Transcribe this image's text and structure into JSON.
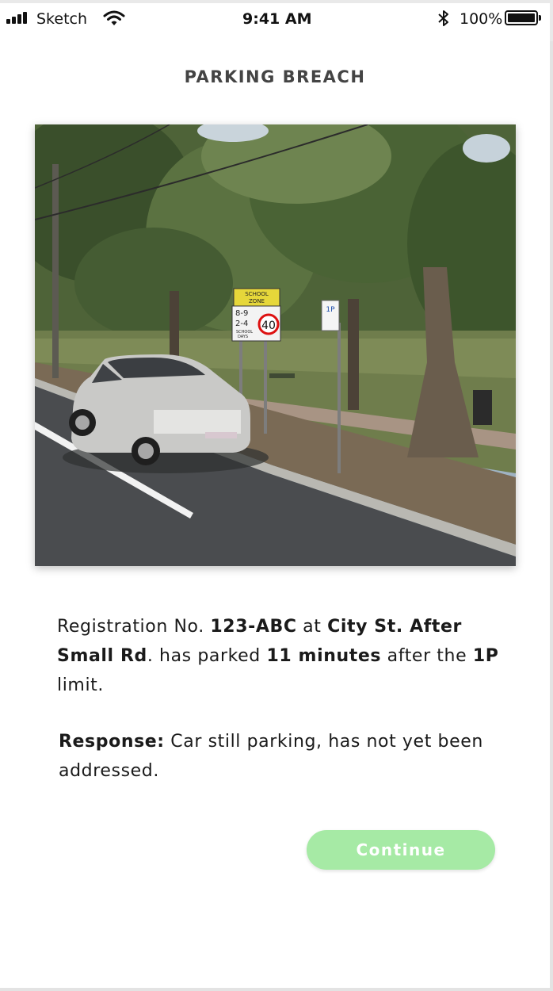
{
  "status_bar": {
    "carrier": "Sketch",
    "time": "9:41 AM",
    "battery_percent": "100%",
    "signal_icon": "signal-bars-icon",
    "wifi_icon": "wifi-icon",
    "bluetooth_icon": "bluetooth-icon",
    "battery_icon": "battery-icon"
  },
  "page": {
    "title": "PARKING BREACH"
  },
  "photo": {
    "sign": {
      "zone_line1": "SCHOOL",
      "zone_line2": "ZONE",
      "hours_1": "8-9",
      "hours_2": "2-4",
      "days_line1": "SCHOOL",
      "days_line2": "DAYS",
      "speed": "40",
      "parking": "1P"
    }
  },
  "breach": {
    "prefix": "Registration No. ",
    "registration": "123-ABC",
    "at": " at ",
    "location": "City St. After Small Rd",
    "parked": ". has parked ",
    "duration": "11 minutes",
    "after": " after the ",
    "limit": "1P",
    "suffix": " limit."
  },
  "response": {
    "label": "Response:",
    "text": " Car still parking, has not yet been addressed."
  },
  "actions": {
    "continue_label": "Continue"
  },
  "colors": {
    "accent": "#a6eaa5",
    "title": "#444444",
    "background": "#ffffff"
  }
}
